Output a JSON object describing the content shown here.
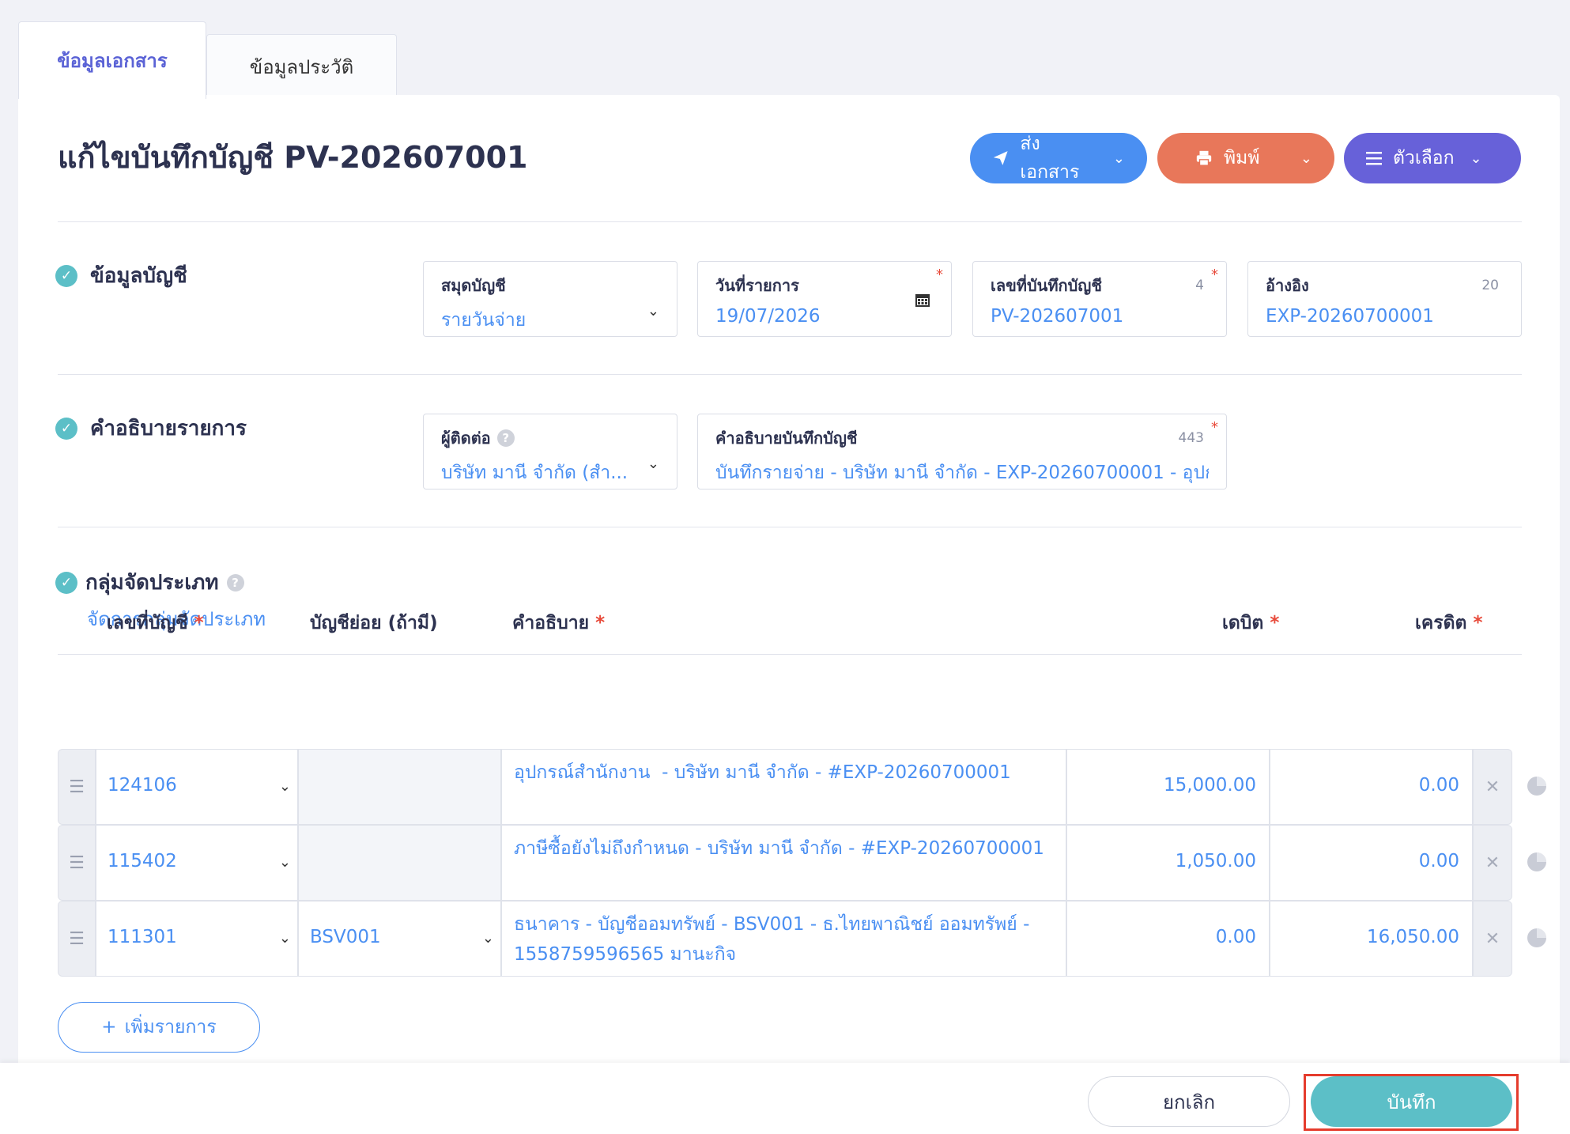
{
  "tabs": {
    "document": "ข้อมูลเอกสาร",
    "history": "ข้อมูลประวัติ"
  },
  "header": {
    "title": "แก้ไขบันทึกบัญชี PV-202607001",
    "send_label": "ส่งเอกสาร",
    "print_label": "พิมพ์",
    "options_label": "ตัวเลือก"
  },
  "account_info": {
    "heading": "ข้อมูลบัญชี",
    "journal_book": {
      "label": "สมุดบัญชี",
      "value": "รายวันจ่าย"
    },
    "txn_date": {
      "label": "วันที่รายการ",
      "value": "19/07/2026",
      "required": "*"
    },
    "journal_no": {
      "label": "เลขที่บันทึกบัญชี",
      "value": "PV-202607001",
      "count": "4",
      "required": "*"
    },
    "reference": {
      "label": "อ้างอิง",
      "value": "EXP-20260700001",
      "count": "20"
    }
  },
  "description": {
    "heading": "คำอธิบายรายการ",
    "contact": {
      "label": "ผู้ติดต่อ",
      "value": "บริษัท มานี จำกัด (สำ..."
    },
    "journal_desc": {
      "label": "คำอธิบายบันทึกบัญชี",
      "value": "บันทึกรายจ่าย - บริษัท มานี จำกัด - EXP-20260700001 - อุปก",
      "count": "443",
      "required": "*"
    }
  },
  "group": {
    "heading": "กลุ่มจัดประเภท",
    "manage_link": "จัดการกลุ่มจัดประเภท"
  },
  "table": {
    "headers": {
      "account": "เลขที่บัญชี",
      "sub": "บัญชีย่อย (ถ้ามี)",
      "desc": "คำอธิบาย",
      "debit": "เดบิต",
      "credit": "เครดิต",
      "star": "*"
    },
    "rows": [
      {
        "account": "124106",
        "sub": "",
        "desc": "อุปกรณ์สำนักงาน  - บริษัท มานี จำกัด - #EXP-20260700001",
        "debit": "15,000.00",
        "credit": "0.00"
      },
      {
        "account": "115402",
        "sub": "",
        "desc": "ภาษีซื้อยังไม่ถึงกำหนด - บริษัท มานี จำกัด - #EXP-20260700001",
        "debit": "1,050.00",
        "credit": "0.00"
      },
      {
        "account": "111301",
        "sub": "BSV001",
        "desc": "ธนาคาร - บัญชีออมทรัพย์ - BSV001 - ธ.ไทยพาณิชย์ ออมทรัพย์ - 1558759596565 มานะกิจ",
        "debit": "0.00",
        "credit": "16,050.00"
      }
    ]
  },
  "add_row_label": "เพิ่มรายการ",
  "footer": {
    "cancel": "ยกเลิก",
    "save": "บันทึก"
  },
  "icons": {
    "send": "paper-plane-icon",
    "print": "printer-icon",
    "options": "menu-icon",
    "chevron": "chevron-down-icon",
    "calendar": "calendar-icon",
    "check": "check-circle-icon",
    "help": "question-icon",
    "drag": "drag-handle-icon",
    "remove": "close-icon",
    "pie": "pie-chart-icon",
    "plus": "plus-icon"
  },
  "colors": {
    "accent": "#4a8ff2",
    "print": "#e8775a",
    "options": "#6761d9",
    "save": "#5cbfc7",
    "required": "#e84a3a",
    "highlight": "#e53c2d"
  }
}
